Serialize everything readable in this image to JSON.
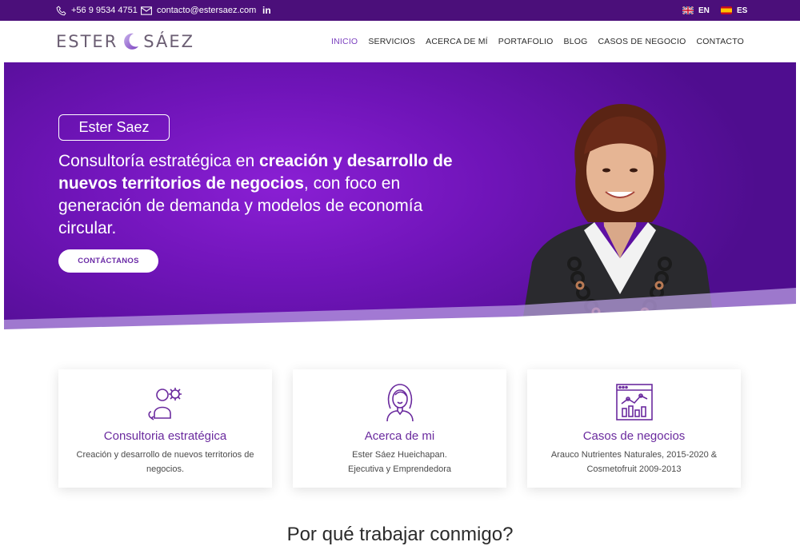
{
  "topbar": {
    "phone": "+56 9 9534 4751",
    "email": "contacto@estersaez.com",
    "linkedin": "in",
    "lang_en": "EN",
    "lang_es": "ES"
  },
  "header": {
    "logo_left": "ESTER",
    "logo_right": "SÁEZ",
    "nav": [
      "INICIO",
      "SERVICIOS",
      "ACERCA DE MÍ",
      "PORTAFOLIO",
      "BLOG",
      "CASOS DE NEGOCIO",
      "CONTACTO"
    ]
  },
  "hero": {
    "tag": "Ester Saez",
    "text_1": "Consultoría estratégica en ",
    "text_bold_1": "creación y desarrollo de nuevos territorios de negocios",
    "text_2": ", con foco en generación de demanda y modelos de economía circular.",
    "button": "CONTÁCTANOS"
  },
  "cards": [
    {
      "icon": "consulting-gears-icon",
      "title": "Consultoria estratégica",
      "desc": "Creación y desarrollo de nuevos territorios de negocios."
    },
    {
      "icon": "woman-avatar-icon",
      "title": "Acerca de mi",
      "desc_line1": "Ester Sáez Hueichapan.",
      "desc_line2": "Ejecutiva y Emprendedora"
    },
    {
      "icon": "chart-dashboard-icon",
      "title": "Casos de negocios",
      "desc": "Arauco Nutrientes Naturales, 2015-2020 & Cosmetofruit 2009-2013"
    }
  ],
  "section_heading": "Por qué trabajar conmigo?",
  "colors": {
    "brand": "#4b0f7a",
    "accent": "#7a3fbf",
    "hero": "#7a17c6"
  }
}
